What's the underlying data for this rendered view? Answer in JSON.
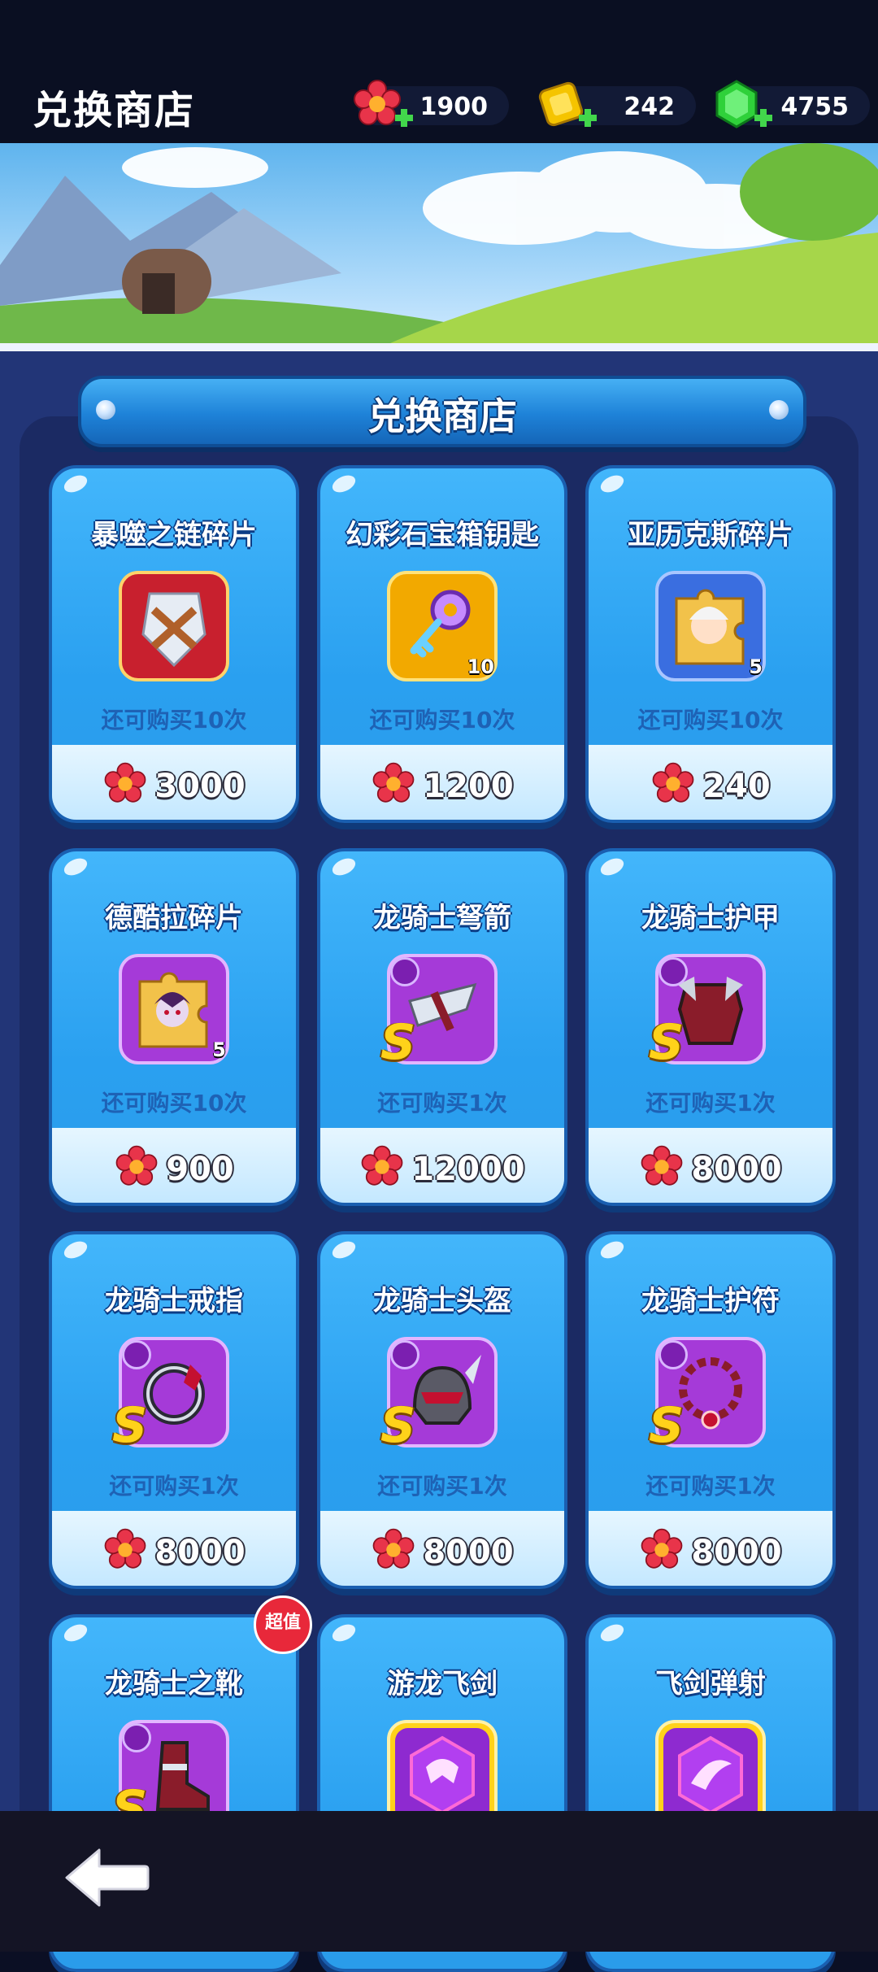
{
  "header": {
    "title": "兑换商店",
    "resources": [
      {
        "name": "flower",
        "value": "1900",
        "color": "#e8344a",
        "icon": "red-flower-icon"
      },
      {
        "name": "gold",
        "value": "242",
        "color": "#f5c400",
        "icon": "gold-bar-icon"
      },
      {
        "name": "gem",
        "value": "4755",
        "color": "#2fd13a",
        "icon": "green-gem-icon"
      }
    ]
  },
  "section": {
    "title": "兑换商店"
  },
  "hot_badge": "超值",
  "items": [
    {
      "name": "暴噬之链碎片",
      "limit": "还可购买10次",
      "price": "3000",
      "qty": "",
      "grade": "",
      "icon": "chain-shard-icon"
    },
    {
      "name": "幻彩石宝箱钥匙",
      "limit": "还可购买10次",
      "price": "1200",
      "qty": "10",
      "grade": "",
      "icon": "key-icon"
    },
    {
      "name": "亚历克斯碎片",
      "limit": "还可购买10次",
      "price": "240",
      "qty": "5",
      "grade": "",
      "icon": "hero-puzzle-icon"
    },
    {
      "name": "德酷拉碎片",
      "limit": "还可购买10次",
      "price": "900",
      "qty": "5",
      "grade": "",
      "icon": "vampire-puzzle-icon"
    },
    {
      "name": "龙骑士弩箭",
      "limit": "还可购买1次",
      "price": "12000",
      "qty": "",
      "grade": "S",
      "icon": "crossbow-icon"
    },
    {
      "name": "龙骑士护甲",
      "limit": "还可购买1次",
      "price": "8000",
      "qty": "",
      "grade": "S",
      "icon": "armor-icon"
    },
    {
      "name": "龙骑士戒指",
      "limit": "还可购买1次",
      "price": "8000",
      "qty": "",
      "grade": "S",
      "icon": "ring-icon"
    },
    {
      "name": "龙骑士头盔",
      "limit": "还可购买1次",
      "price": "8000",
      "qty": "",
      "grade": "S",
      "icon": "helmet-icon"
    },
    {
      "name": "龙骑士护符",
      "limit": "还可购买1次",
      "price": "8000",
      "qty": "",
      "grade": "S",
      "icon": "amulet-icon"
    },
    {
      "name": "龙骑士之靴",
      "limit": "",
      "price": "",
      "qty": "",
      "grade": "S",
      "icon": "boots-icon"
    },
    {
      "name": "游龙飞剑",
      "limit": "",
      "price": "",
      "qty": "",
      "grade": "",
      "icon": "dragon-sword-icon"
    },
    {
      "name": "飞剑弹射",
      "limit": "",
      "price": "",
      "qty": "",
      "grade": "",
      "icon": "sword-bounce-icon"
    }
  ],
  "nav": {
    "back_icon": "back-arrow-icon"
  }
}
